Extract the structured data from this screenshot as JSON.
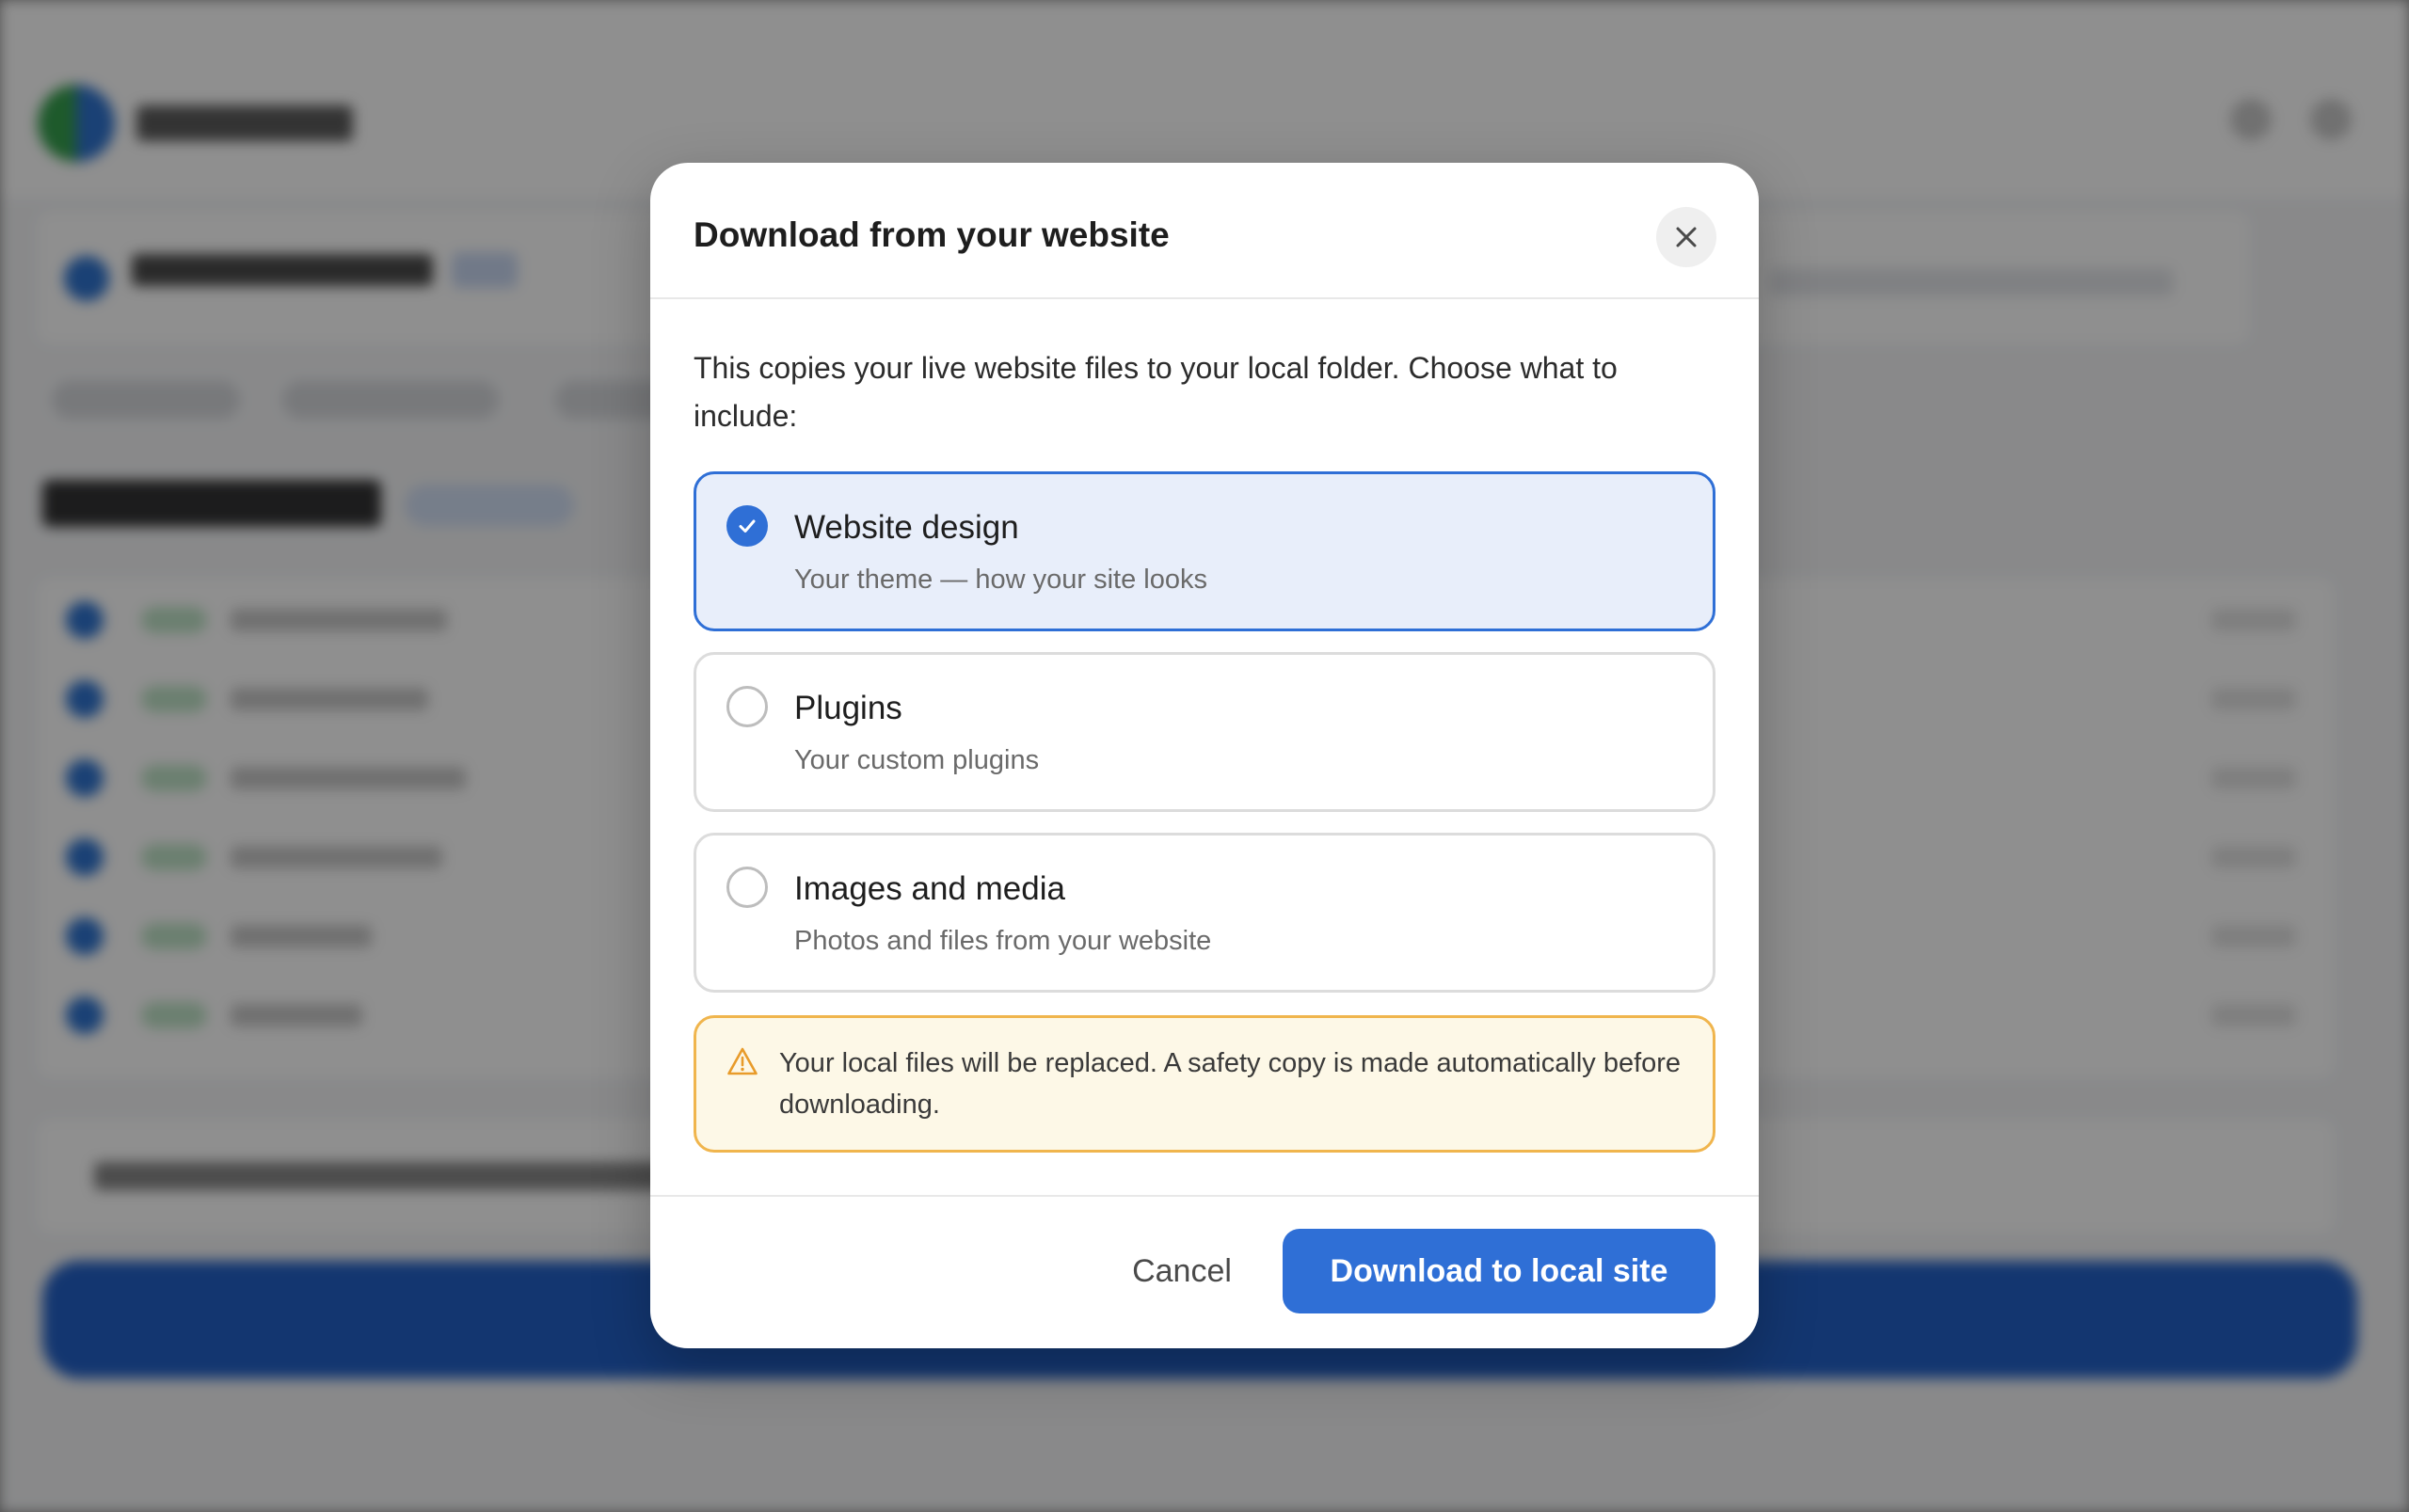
{
  "dialog": {
    "title": "Download from your website",
    "intro": "This copies your live website files to your local folder. Choose what to include:",
    "options": [
      {
        "title": "Website design",
        "subtitle": "Your theme — how your site looks",
        "selected": true
      },
      {
        "title": "Plugins",
        "subtitle": "Your custom plugins",
        "selected": false
      },
      {
        "title": "Images and media",
        "subtitle": "Photos and files from your website",
        "selected": false
      }
    ],
    "warning": {
      "icon": "warning-triangle-icon",
      "text": "Your local files will be replaced. A safety copy is made automatically before downloading."
    },
    "close_icon": "close-icon",
    "cancel_label": "Cancel",
    "confirm_label": "Download to local site"
  },
  "colors": {
    "accent": "#2f6fd6",
    "selected_background": "#e8eefa",
    "warning_border": "#f0b54d",
    "warning_background": "#fdf8e7"
  }
}
